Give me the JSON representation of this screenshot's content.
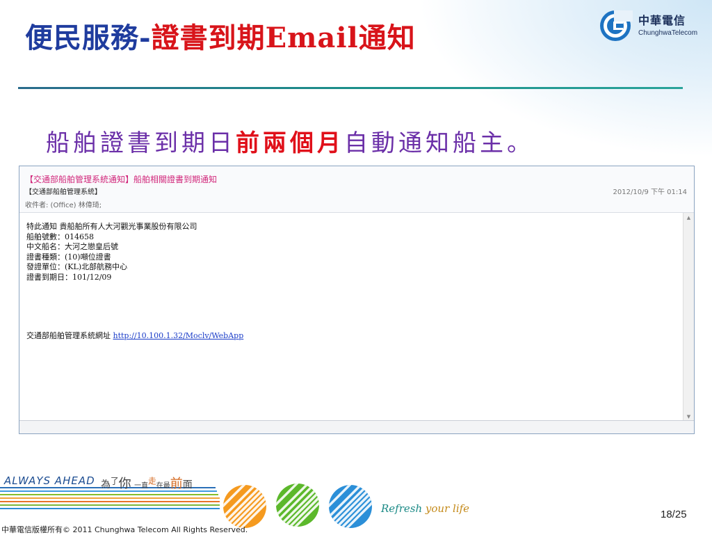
{
  "title": {
    "part1": "便民服務-",
    "part2": "證書到期Email通知"
  },
  "logo": {
    "cn": "中華電信",
    "en": "ChunghwaTelecom"
  },
  "subtitle": {
    "pre": "船舶證書到期日",
    "highlight": "前兩個月",
    "post": "自動通知船主。"
  },
  "email": {
    "subject": "【交通部船舶管理系統通知】船舶相關證書到期通知",
    "from": "【交通部船舶管理系統】",
    "date": "2012/10/9 下午 01:14",
    "to": "收件者: (Office) 林偉琦;",
    "body_lines": [
      "特此通知 貴船舶所有人大河觀光事業股份有限公司",
      "船舶號數：014658",
      "中文船名：大河之戀皇后號",
      "證書種類：(10)噸位證書",
      "發證單位：(KL)北部航務中心",
      "證書到期日：101/12/09"
    ],
    "site_label": "交通部船舶管理系統網址",
    "site_url": "http://10.100.1.32/Moclv/WebApp"
  },
  "footer": {
    "always_ahead": "ALWAYS AHEAD",
    "slogan": {
      "a": "為",
      "b": "了",
      "c": "你",
      "d": "一直",
      "e": "走",
      "f": "在最",
      "g": "前",
      "h": "面"
    },
    "refresh_a": "Refresh",
    "refresh_b": "your life",
    "page": "18/25",
    "copyright": "中華電信版權所有© 2011 Chunghwa Telecom All Rights Reserved."
  }
}
